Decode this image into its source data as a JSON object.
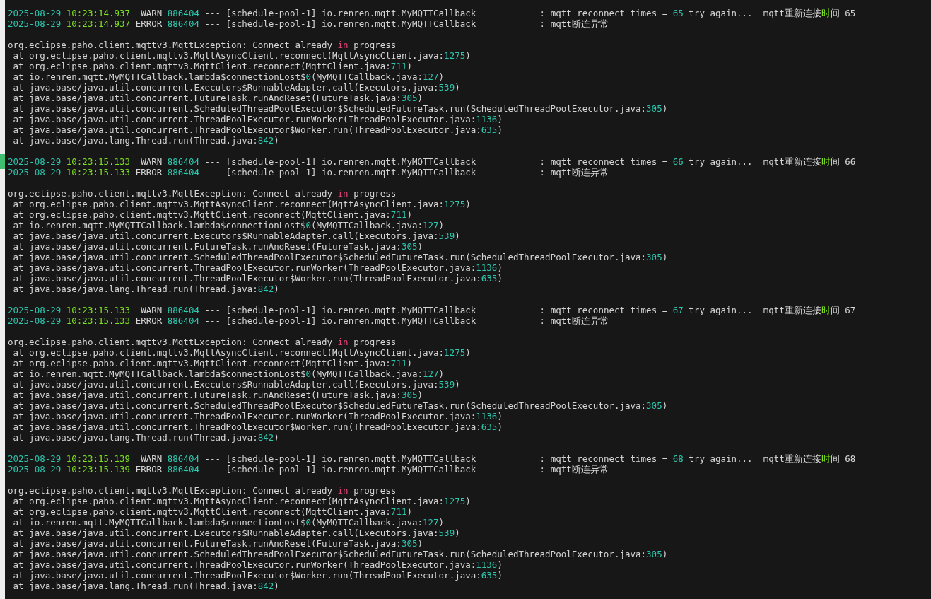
{
  "blocks": [
    {
      "marked": false,
      "header_lines": [
        [
          {
            "text": "2025-08-29 ",
            "kind": "date"
          },
          {
            "text": "10:23:14.937",
            "kind": "time"
          },
          {
            "text": "  WARN ",
            "kind": "plain"
          },
          {
            "text": "886404",
            "kind": "num"
          },
          {
            "text": " --- [schedule-pool-1] io.renren.mqtt.MyMQTTCallback            : mqtt reconnect times = ",
            "kind": "plain"
          },
          {
            "text": "65",
            "kind": "num"
          },
          {
            "text": " try again...  mqtt重新连接",
            "kind": "plain"
          },
          {
            "text": "时",
            "kind": "time"
          },
          {
            "text": "间 65",
            "kind": "plain"
          }
        ],
        [
          {
            "text": "2025-08-29 ",
            "kind": "date"
          },
          {
            "text": "10:23:14.937",
            "kind": "time"
          },
          {
            "text": " ERROR ",
            "kind": "plain"
          },
          {
            "text": "886404",
            "kind": "num"
          },
          {
            "text": " --- [schedule-pool-1] io.renren.mqtt.MyMQTTCallback            : mqtt断连异常",
            "kind": "plain"
          }
        ]
      ],
      "stack_lines": [
        [
          {
            "text": "org.eclipse.paho.client.mqttv3.MqttException: Connect already ",
            "kind": "plain"
          },
          {
            "text": "in",
            "kind": "keyword"
          },
          {
            "text": " progress",
            "kind": "plain"
          }
        ],
        [
          {
            "text": " at org.eclipse.paho.client.mqttv3.MqttAsyncClient.reconnect(MqttAsyncClient.java:",
            "kind": "plain"
          },
          {
            "text": "1275",
            "kind": "num"
          },
          {
            "text": ")",
            "kind": "plain"
          }
        ],
        [
          {
            "text": " at org.eclipse.paho.client.mqttv3.MqttClient.reconnect(MqttClient.java:",
            "kind": "plain"
          },
          {
            "text": "711",
            "kind": "num"
          },
          {
            "text": ")",
            "kind": "plain"
          }
        ],
        [
          {
            "text": " at io.renren.mqtt.MyMQTTCallback.lambda$connectionLost$",
            "kind": "plain"
          },
          {
            "text": "0",
            "kind": "num"
          },
          {
            "text": "(MyMQTTCallback.java:",
            "kind": "plain"
          },
          {
            "text": "127",
            "kind": "num"
          },
          {
            "text": ")",
            "kind": "plain"
          }
        ],
        [
          {
            "text": " at java.base/java.util.concurrent.Executors$RunnableAdapter.call(Executors.java:",
            "kind": "plain"
          },
          {
            "text": "539",
            "kind": "num"
          },
          {
            "text": ")",
            "kind": "plain"
          }
        ],
        [
          {
            "text": " at java.base/java.util.concurrent.FutureTask.runAndReset(FutureTask.java:",
            "kind": "plain"
          },
          {
            "text": "305",
            "kind": "num"
          },
          {
            "text": ")",
            "kind": "plain"
          }
        ],
        [
          {
            "text": " at java.base/java.util.concurrent.ScheduledThreadPoolExecutor$ScheduledFutureTask.run(ScheduledThreadPoolExecutor.java:",
            "kind": "plain"
          },
          {
            "text": "305",
            "kind": "num"
          },
          {
            "text": ")",
            "kind": "plain"
          }
        ],
        [
          {
            "text": " at java.base/java.util.concurrent.ThreadPoolExecutor.runWorker(ThreadPoolExecutor.java:",
            "kind": "plain"
          },
          {
            "text": "1136",
            "kind": "num"
          },
          {
            "text": ")",
            "kind": "plain"
          }
        ],
        [
          {
            "text": " at java.base/java.util.concurrent.ThreadPoolExecutor$Worker.run(ThreadPoolExecutor.java:",
            "kind": "plain"
          },
          {
            "text": "635",
            "kind": "num"
          },
          {
            "text": ")",
            "kind": "plain"
          }
        ],
        [
          {
            "text": " at java.base/java.lang.Thread.run(Thread.java:",
            "kind": "plain"
          },
          {
            "text": "842",
            "kind": "num"
          },
          {
            "text": ")",
            "kind": "plain"
          }
        ]
      ]
    },
    {
      "marked": true,
      "header_lines": [
        [
          {
            "text": "2025-08-29 ",
            "kind": "date"
          },
          {
            "text": "10:23:15.133",
            "kind": "time"
          },
          {
            "text": "  WARN ",
            "kind": "plain"
          },
          {
            "text": "886404",
            "kind": "num"
          },
          {
            "text": " --- [schedule-pool-1] io.renren.mqtt.MyMQTTCallback            : mqtt reconnect times = ",
            "kind": "plain"
          },
          {
            "text": "66",
            "kind": "num"
          },
          {
            "text": " try again...  mqtt重新连接",
            "kind": "plain"
          },
          {
            "text": "时",
            "kind": "time"
          },
          {
            "text": "间 66",
            "kind": "plain"
          }
        ],
        [
          {
            "text": "2025-08-29 ",
            "kind": "date"
          },
          {
            "text": "10:23:15.133",
            "kind": "time"
          },
          {
            "text": " ERROR ",
            "kind": "plain"
          },
          {
            "text": "886404",
            "kind": "num"
          },
          {
            "text": " --- [schedule-pool-1] io.renren.mqtt.MyMQTTCallback            : mqtt断连异常",
            "kind": "plain"
          }
        ]
      ],
      "stack_lines": [
        [
          {
            "text": "org.eclipse.paho.client.mqttv3.MqttException: Connect already ",
            "kind": "plain"
          },
          {
            "text": "in",
            "kind": "keyword"
          },
          {
            "text": " progress",
            "kind": "plain"
          }
        ],
        [
          {
            "text": " at org.eclipse.paho.client.mqttv3.MqttAsyncClient.reconnect(MqttAsyncClient.java:",
            "kind": "plain"
          },
          {
            "text": "1275",
            "kind": "num"
          },
          {
            "text": ")",
            "kind": "plain"
          }
        ],
        [
          {
            "text": " at org.eclipse.paho.client.mqttv3.MqttClient.reconnect(MqttClient.java:",
            "kind": "plain"
          },
          {
            "text": "711",
            "kind": "num"
          },
          {
            "text": ")",
            "kind": "plain"
          }
        ],
        [
          {
            "text": " at io.renren.mqtt.MyMQTTCallback.lambda$connectionLost$",
            "kind": "plain"
          },
          {
            "text": "0",
            "kind": "num"
          },
          {
            "text": "(MyMQTTCallback.java:",
            "kind": "plain"
          },
          {
            "text": "127",
            "kind": "num"
          },
          {
            "text": ")",
            "kind": "plain"
          }
        ],
        [
          {
            "text": " at java.base/java.util.concurrent.Executors$RunnableAdapter.call(Executors.java:",
            "kind": "plain"
          },
          {
            "text": "539",
            "kind": "num"
          },
          {
            "text": ")",
            "kind": "plain"
          }
        ],
        [
          {
            "text": " at java.base/java.util.concurrent.FutureTask.runAndReset(FutureTask.java:",
            "kind": "plain"
          },
          {
            "text": "305",
            "kind": "num"
          },
          {
            "text": ")",
            "kind": "plain"
          }
        ],
        [
          {
            "text": " at java.base/java.util.concurrent.ScheduledThreadPoolExecutor$ScheduledFutureTask.run(ScheduledThreadPoolExecutor.java:",
            "kind": "plain"
          },
          {
            "text": "305",
            "kind": "num"
          },
          {
            "text": ")",
            "kind": "plain"
          }
        ],
        [
          {
            "text": " at java.base/java.util.concurrent.ThreadPoolExecutor.runWorker(ThreadPoolExecutor.java:",
            "kind": "plain"
          },
          {
            "text": "1136",
            "kind": "num"
          },
          {
            "text": ")",
            "kind": "plain"
          }
        ],
        [
          {
            "text": " at java.base/java.util.concurrent.ThreadPoolExecutor$Worker.run(ThreadPoolExecutor.java:",
            "kind": "plain"
          },
          {
            "text": "635",
            "kind": "num"
          },
          {
            "text": ")",
            "kind": "plain"
          }
        ],
        [
          {
            "text": " at java.base/java.lang.Thread.run(Thread.java:",
            "kind": "plain"
          },
          {
            "text": "842",
            "kind": "num"
          },
          {
            "text": ")",
            "kind": "plain"
          }
        ]
      ]
    },
    {
      "marked": false,
      "header_lines": [
        [
          {
            "text": "2025-08-29 ",
            "kind": "date"
          },
          {
            "text": "10:23:15.133",
            "kind": "time"
          },
          {
            "text": "  WARN ",
            "kind": "plain"
          },
          {
            "text": "886404",
            "kind": "num"
          },
          {
            "text": " --- [schedule-pool-1] io.renren.mqtt.MyMQTTCallback            : mqtt reconnect times = ",
            "kind": "plain"
          },
          {
            "text": "67",
            "kind": "num"
          },
          {
            "text": " try again...  mqtt重新连接",
            "kind": "plain"
          },
          {
            "text": "时",
            "kind": "time"
          },
          {
            "text": "间 67",
            "kind": "plain"
          }
        ],
        [
          {
            "text": "2025-08-29 ",
            "kind": "date"
          },
          {
            "text": "10:23:15.133",
            "kind": "time"
          },
          {
            "text": " ERROR ",
            "kind": "plain"
          },
          {
            "text": "886404",
            "kind": "num"
          },
          {
            "text": " --- [schedule-pool-1] io.renren.mqtt.MyMQTTCallback            : mqtt断连异常",
            "kind": "plain"
          }
        ]
      ],
      "stack_lines": [
        [
          {
            "text": "org.eclipse.paho.client.mqttv3.MqttException: Connect already ",
            "kind": "plain"
          },
          {
            "text": "in",
            "kind": "keyword"
          },
          {
            "text": " progress",
            "kind": "plain"
          }
        ],
        [
          {
            "text": " at org.eclipse.paho.client.mqttv3.MqttAsyncClient.reconnect(MqttAsyncClient.java:",
            "kind": "plain"
          },
          {
            "text": "1275",
            "kind": "num"
          },
          {
            "text": ")",
            "kind": "plain"
          }
        ],
        [
          {
            "text": " at org.eclipse.paho.client.mqttv3.MqttClient.reconnect(MqttClient.java:",
            "kind": "plain"
          },
          {
            "text": "711",
            "kind": "num"
          },
          {
            "text": ")",
            "kind": "plain"
          }
        ],
        [
          {
            "text": " at io.renren.mqtt.MyMQTTCallback.lambda$connectionLost$",
            "kind": "plain"
          },
          {
            "text": "0",
            "kind": "num"
          },
          {
            "text": "(MyMQTTCallback.java:",
            "kind": "plain"
          },
          {
            "text": "127",
            "kind": "num"
          },
          {
            "text": ")",
            "kind": "plain"
          }
        ],
        [
          {
            "text": " at java.base/java.util.concurrent.Executors$RunnableAdapter.call(Executors.java:",
            "kind": "plain"
          },
          {
            "text": "539",
            "kind": "num"
          },
          {
            "text": ")",
            "kind": "plain"
          }
        ],
        [
          {
            "text": " at java.base/java.util.concurrent.FutureTask.runAndReset(FutureTask.java:",
            "kind": "plain"
          },
          {
            "text": "305",
            "kind": "num"
          },
          {
            "text": ")",
            "kind": "plain"
          }
        ],
        [
          {
            "text": " at java.base/java.util.concurrent.ScheduledThreadPoolExecutor$ScheduledFutureTask.run(ScheduledThreadPoolExecutor.java:",
            "kind": "plain"
          },
          {
            "text": "305",
            "kind": "num"
          },
          {
            "text": ")",
            "kind": "plain"
          }
        ],
        [
          {
            "text": " at java.base/java.util.concurrent.ThreadPoolExecutor.runWorker(ThreadPoolExecutor.java:",
            "kind": "plain"
          },
          {
            "text": "1136",
            "kind": "num"
          },
          {
            "text": ")",
            "kind": "plain"
          }
        ],
        [
          {
            "text": " at java.base/java.util.concurrent.ThreadPoolExecutor$Worker.run(ThreadPoolExecutor.java:",
            "kind": "plain"
          },
          {
            "text": "635",
            "kind": "num"
          },
          {
            "text": ")",
            "kind": "plain"
          }
        ],
        [
          {
            "text": " at java.base/java.lang.Thread.run(Thread.java:",
            "kind": "plain"
          },
          {
            "text": "842",
            "kind": "num"
          },
          {
            "text": ")",
            "kind": "plain"
          }
        ]
      ]
    },
    {
      "marked": false,
      "header_lines": [
        [
          {
            "text": "2025-08-29 ",
            "kind": "date"
          },
          {
            "text": "10:23:15.139",
            "kind": "time"
          },
          {
            "text": "  WARN ",
            "kind": "plain"
          },
          {
            "text": "886404",
            "kind": "num"
          },
          {
            "text": " --- [schedule-pool-1] io.renren.mqtt.MyMQTTCallback            : mqtt reconnect times = ",
            "kind": "plain"
          },
          {
            "text": "68",
            "kind": "num"
          },
          {
            "text": " try again...  mqtt重新连接",
            "kind": "plain"
          },
          {
            "text": "时",
            "kind": "time"
          },
          {
            "text": "间 68",
            "kind": "plain"
          }
        ],
        [
          {
            "text": "2025-08-29 ",
            "kind": "date"
          },
          {
            "text": "10:23:15.139",
            "kind": "time"
          },
          {
            "text": " ERROR ",
            "kind": "plain"
          },
          {
            "text": "886404",
            "kind": "num"
          },
          {
            "text": " --- [schedule-pool-1] io.renren.mqtt.MyMQTTCallback            : mqtt断连异常",
            "kind": "plain"
          }
        ]
      ],
      "stack_lines": [
        [
          {
            "text": "org.eclipse.paho.client.mqttv3.MqttException: Connect already ",
            "kind": "plain"
          },
          {
            "text": "in",
            "kind": "keyword"
          },
          {
            "text": " progress",
            "kind": "plain"
          }
        ],
        [
          {
            "text": " at org.eclipse.paho.client.mqttv3.MqttAsyncClient.reconnect(MqttAsyncClient.java:",
            "kind": "plain"
          },
          {
            "text": "1275",
            "kind": "num"
          },
          {
            "text": ")",
            "kind": "plain"
          }
        ],
        [
          {
            "text": " at org.eclipse.paho.client.mqttv3.MqttClient.reconnect(MqttClient.java:",
            "kind": "plain"
          },
          {
            "text": "711",
            "kind": "num"
          },
          {
            "text": ")",
            "kind": "plain"
          }
        ],
        [
          {
            "text": " at io.renren.mqtt.MyMQTTCallback.lambda$connectionLost$",
            "kind": "plain"
          },
          {
            "text": "0",
            "kind": "num"
          },
          {
            "text": "(MyMQTTCallback.java:",
            "kind": "plain"
          },
          {
            "text": "127",
            "kind": "num"
          },
          {
            "text": ")",
            "kind": "plain"
          }
        ],
        [
          {
            "text": " at java.base/java.util.concurrent.Executors$RunnableAdapter.call(Executors.java:",
            "kind": "plain"
          },
          {
            "text": "539",
            "kind": "num"
          },
          {
            "text": ")",
            "kind": "plain"
          }
        ],
        [
          {
            "text": " at java.base/java.util.concurrent.FutureTask.runAndReset(FutureTask.java:",
            "kind": "plain"
          },
          {
            "text": "305",
            "kind": "num"
          },
          {
            "text": ")",
            "kind": "plain"
          }
        ],
        [
          {
            "text": " at java.base/java.util.concurrent.ScheduledThreadPoolExecutor$ScheduledFutureTask.run(ScheduledThreadPoolExecutor.java:",
            "kind": "plain"
          },
          {
            "text": "305",
            "kind": "num"
          },
          {
            "text": ")",
            "kind": "plain"
          }
        ],
        [
          {
            "text": " at java.base/java.util.concurrent.ThreadPoolExecutor.runWorker(ThreadPoolExecutor.java:",
            "kind": "plain"
          },
          {
            "text": "1136",
            "kind": "num"
          },
          {
            "text": ")",
            "kind": "plain"
          }
        ],
        [
          {
            "text": " at java.base/java.util.concurrent.ThreadPoolExecutor$Worker.run(ThreadPoolExecutor.java:",
            "kind": "plain"
          },
          {
            "text": "635",
            "kind": "num"
          },
          {
            "text": ")",
            "kind": "plain"
          }
        ],
        [
          {
            "text": " at java.base/java.lang.Thread.run(Thread.java:",
            "kind": "plain"
          },
          {
            "text": "842",
            "kind": "num"
          },
          {
            "text": ")",
            "kind": "plain"
          }
        ]
      ]
    }
  ]
}
